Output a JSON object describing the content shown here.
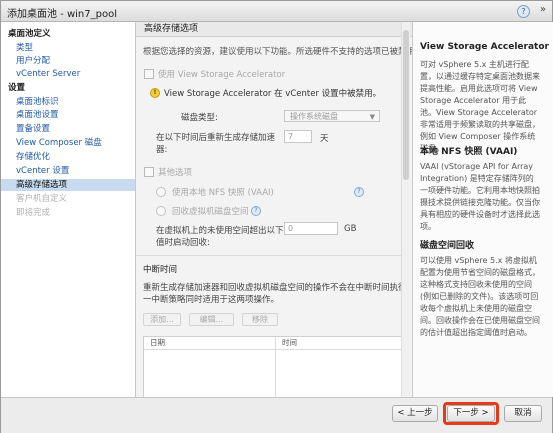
{
  "window": {
    "title": "添加桌面池 - win7_pool",
    "help_glyph": "?",
    "expand_glyph": "»"
  },
  "sidebar": {
    "sections": [
      {
        "label": "桌面池定义",
        "items": [
          "类型",
          "用户分配",
          "vCenter Server"
        ]
      },
      {
        "label": "设置",
        "items": [
          "桌面池标识",
          "桌面池设置",
          "置备设置",
          "View Composer 磁盘",
          "存储优化",
          "vCenter 设置",
          "高级存储选项",
          "客户机自定义",
          "即将完成"
        ]
      }
    ],
    "selected": "高级存储选项",
    "disabled": [
      "客户机自定义",
      "即将完成"
    ]
  },
  "main": {
    "section_title": "高级存储选项",
    "intro": "根据您选择的资源，建议使用以下功能。所选硬件不支持的选项已被禁用。",
    "vsa_checkbox": "使用 View Storage Accelerator",
    "vsa_warning": "View Storage Accelerator 在 vCenter 设置中被禁用。",
    "disk_type_label": "磁盘类型:",
    "disk_type_value": "操作系统磁盘",
    "regen_label_1": "在以下时间后重新生成存储加速",
    "regen_label_2": "器:",
    "regen_value": "7",
    "regen_unit": "天",
    "other_checkbox": "其他选项",
    "nfs_radio": "使用本地 NFS 快照 (VAAI)",
    "reclaim_radio": "回收虚拟机磁盘空间",
    "reclaim_label_1": "在虚拟机上的未使用空间超出以下",
    "reclaim_label_2": "值时启动回收:",
    "reclaim_value": "0",
    "reclaim_unit": "GB",
    "blackout_title": "中断时间",
    "blackout_desc_1": "重新生成存储加速器和回收虚拟机磁盘空间的操作不会在中断时间执行。同",
    "blackout_desc_2": "一中断策略同时适用于这两项操作。",
    "buttons": {
      "add": "添加...",
      "edit": "编辑...",
      "remove": "移除"
    },
    "table_headers": [
      "日期",
      "时间"
    ]
  },
  "help": {
    "vsa_title": "View Storage Accelerator",
    "vsa_text": "可对 vSphere 5.x 主机进行配置，以通过缓存特定桌面池数据来提高性能。启用此选项可将 View Storage Accelerator 用于此池。View Storage Accelerator 非常适用于频繁读取的共享磁盘，例如 View Composer 操作系统磁盘。",
    "nfs_title": "本地 NFS 快照 (VAAI)",
    "nfs_text": "VAAI (vStorage API for Array Integration) 是特定存储阵列的一项硬件功能。它利用本地快照拍摄技术提供链接克隆功能。仅当你具有相应的硬件设备时才选择此选项。",
    "reclaim_title": "磁盘空间回收",
    "reclaim_text": "可以使用 vSphere 5.x 将虚拟机配置为使用节省空间的磁盘格式，这种格式支持回收未使用的空间 (例如已删除的文件)。该选项可回收每个虚拟机上未使用的磁盘空间。回收操作会在已使用磁盘空间的估计值超出指定阈值时启动。"
  },
  "footer": {
    "back": "< 上一步",
    "next": "下一步 >",
    "cancel": "取消"
  },
  "colors": {
    "accent": "#1f5aa8",
    "selection": "#c7daf0",
    "highlight_box": "#e63a1a"
  }
}
